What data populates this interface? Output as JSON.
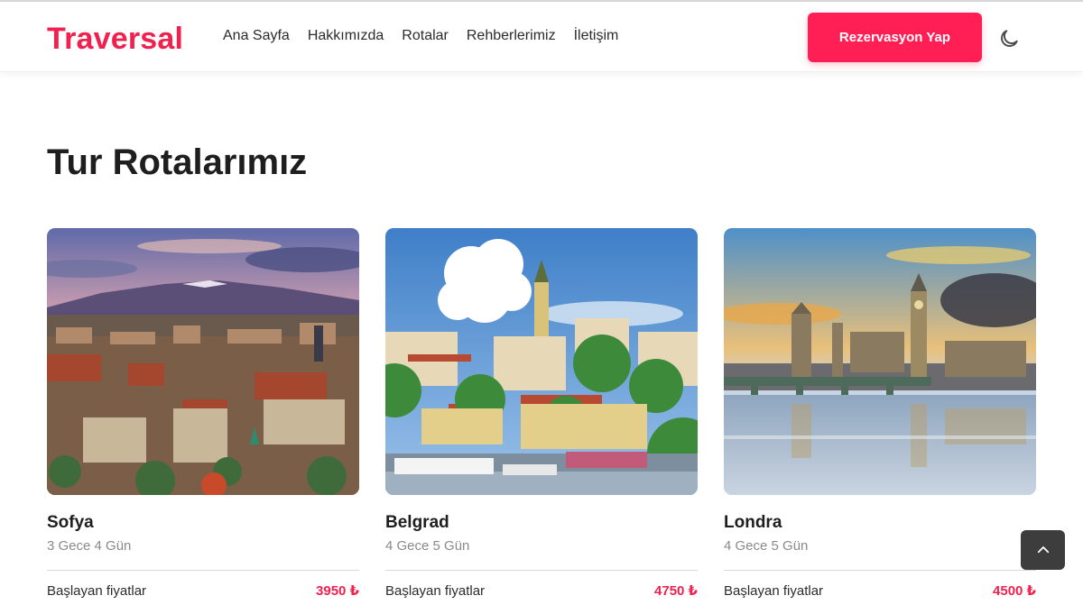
{
  "header": {
    "brand": "Traversal",
    "nav": [
      "Ana Sayfa",
      "Hakkımızda",
      "Rotalar",
      "Rehberlerimiz",
      "İletişim"
    ],
    "cta_label": "Rezervasyon Yap",
    "theme_icon": "moon-icon"
  },
  "routes": {
    "title": "Tur Rotalarımız",
    "cards": [
      {
        "name": "Sofya",
        "duration": "3 Gece 4 Gün",
        "price_label": "Başlayan fiyatlar",
        "price": "3950 ₺"
      },
      {
        "name": "Belgrad",
        "duration": "4 Gece 5 Gün",
        "price_label": "Başlayan fiyatlar",
        "price": "4750 ₺"
      },
      {
        "name": "Londra",
        "duration": "4 Gece 5 Gün",
        "price_label": "Başlayan fiyatlar",
        "price": "4500 ₺"
      }
    ]
  },
  "colors": {
    "accent": "#ff1f55",
    "brand": "#f0204f",
    "back_to_top_bg": "#3d3d3d"
  },
  "back_to_top_icon": "chevron-up-icon"
}
